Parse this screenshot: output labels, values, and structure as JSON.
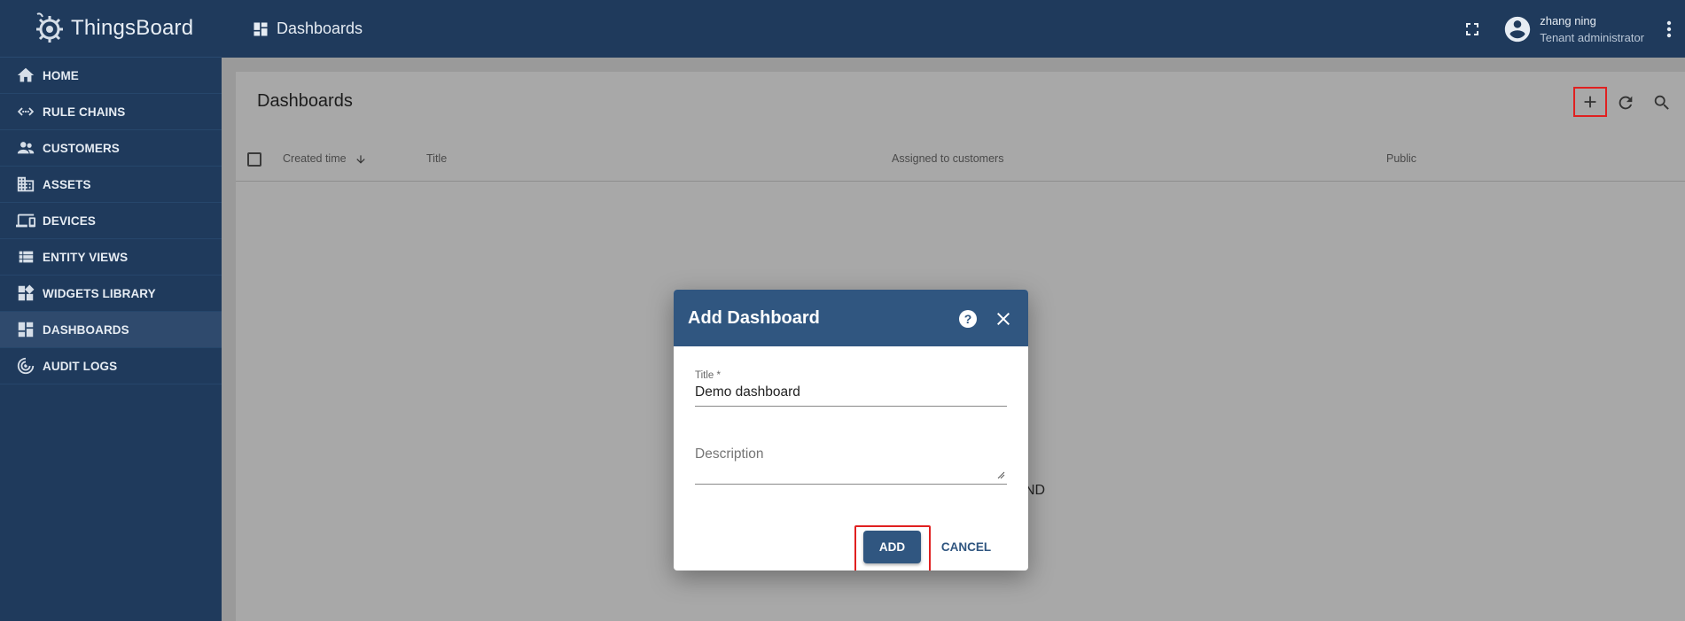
{
  "app": {
    "name": "ThingsBoard"
  },
  "sidebar": {
    "items": [
      {
        "label": "HOME",
        "icon": "home-icon"
      },
      {
        "label": "RULE CHAINS",
        "icon": "rule-chains-icon"
      },
      {
        "label": "CUSTOMERS",
        "icon": "customers-icon"
      },
      {
        "label": "ASSETS",
        "icon": "assets-icon"
      },
      {
        "label": "DEVICES",
        "icon": "devices-icon"
      },
      {
        "label": "ENTITY VIEWS",
        "icon": "entity-views-icon"
      },
      {
        "label": "WIDGETS LIBRARY",
        "icon": "widgets-icon"
      },
      {
        "label": "DASHBOARDS",
        "icon": "dashboards-icon",
        "active": true
      },
      {
        "label": "AUDIT LOGS",
        "icon": "audit-logs-icon"
      }
    ]
  },
  "header": {
    "breadcrumb": "Dashboards",
    "user": {
      "name": "zhang ning",
      "role": "Tenant administrator"
    }
  },
  "main": {
    "title": "Dashboards",
    "columns": [
      "Created time",
      "Title",
      "Assigned to customers",
      "Public"
    ],
    "empty_text_partial": "ND"
  },
  "dialog": {
    "title": "Add Dashboard",
    "title_field": {
      "label": "Title *",
      "value": "Demo dashboard"
    },
    "description_field": {
      "placeholder": "Description"
    },
    "add_label": "ADD",
    "cancel_label": "CANCEL"
  },
  "colors": {
    "sidebar_bg": "#1f3a5c",
    "dialog_header": "#305680",
    "highlight": "#e02020"
  }
}
